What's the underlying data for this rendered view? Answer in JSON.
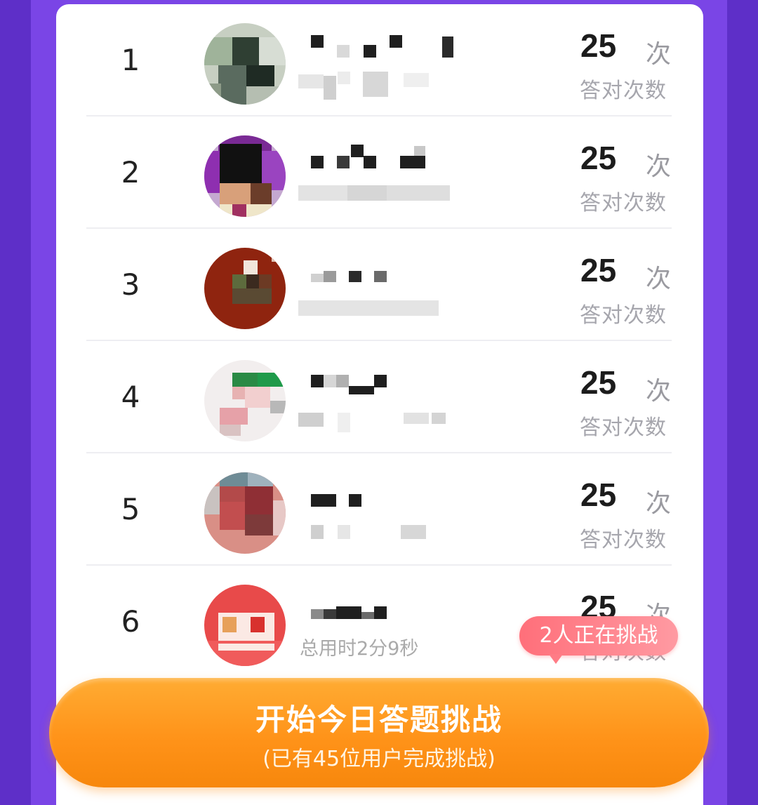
{
  "leaderboard": {
    "rows": [
      {
        "rank": "1",
        "score": "25",
        "unit": "次",
        "score_label": "答对次数",
        "time": ""
      },
      {
        "rank": "2",
        "score": "25",
        "unit": "次",
        "score_label": "答对次数",
        "time": ""
      },
      {
        "rank": "3",
        "score": "25",
        "unit": "次",
        "score_label": "答对次数",
        "time": ""
      },
      {
        "rank": "4",
        "score": "25",
        "unit": "次",
        "score_label": "答对次数",
        "time": ""
      },
      {
        "rank": "5",
        "score": "25",
        "unit": "次",
        "score_label": "答对次数",
        "time": ""
      },
      {
        "rank": "6",
        "score": "25",
        "unit": "次",
        "score_label": "答对次数",
        "time": "总用时2分9秒"
      }
    ]
  },
  "bubble": {
    "text": "2人正在挑战"
  },
  "cta": {
    "title": "开始今日答题挑战",
    "subtitle": "(已有45位用户完成挑战)"
  },
  "colors": {
    "background": "#7a45e6",
    "card": "#ffffff",
    "cta": "#ff9319",
    "bubble": "#ff7c86"
  },
  "icons": [
    "avatar-image",
    "pixelated-name"
  ]
}
